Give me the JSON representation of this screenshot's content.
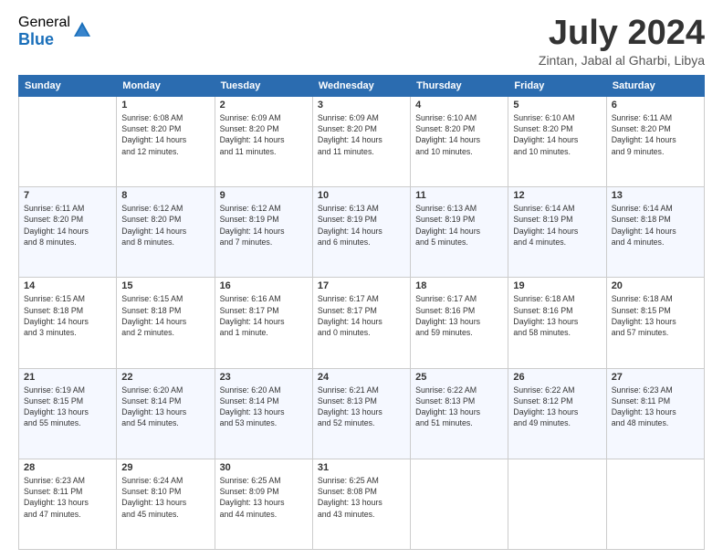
{
  "logo": {
    "general": "General",
    "blue": "Blue"
  },
  "title": "July 2024",
  "location": "Zintan, Jabal al Gharbi, Libya",
  "days_of_week": [
    "Sunday",
    "Monday",
    "Tuesday",
    "Wednesday",
    "Thursday",
    "Friday",
    "Saturday"
  ],
  "weeks": [
    [
      {
        "day": "",
        "info": ""
      },
      {
        "day": "1",
        "info": "Sunrise: 6:08 AM\nSunset: 8:20 PM\nDaylight: 14 hours\nand 12 minutes."
      },
      {
        "day": "2",
        "info": "Sunrise: 6:09 AM\nSunset: 8:20 PM\nDaylight: 14 hours\nand 11 minutes."
      },
      {
        "day": "3",
        "info": "Sunrise: 6:09 AM\nSunset: 8:20 PM\nDaylight: 14 hours\nand 11 minutes."
      },
      {
        "day": "4",
        "info": "Sunrise: 6:10 AM\nSunset: 8:20 PM\nDaylight: 14 hours\nand 10 minutes."
      },
      {
        "day": "5",
        "info": "Sunrise: 6:10 AM\nSunset: 8:20 PM\nDaylight: 14 hours\nand 10 minutes."
      },
      {
        "day": "6",
        "info": "Sunrise: 6:11 AM\nSunset: 8:20 PM\nDaylight: 14 hours\nand 9 minutes."
      }
    ],
    [
      {
        "day": "7",
        "info": "Sunrise: 6:11 AM\nSunset: 8:20 PM\nDaylight: 14 hours\nand 8 minutes."
      },
      {
        "day": "8",
        "info": "Sunrise: 6:12 AM\nSunset: 8:20 PM\nDaylight: 14 hours\nand 8 minutes."
      },
      {
        "day": "9",
        "info": "Sunrise: 6:12 AM\nSunset: 8:19 PM\nDaylight: 14 hours\nand 7 minutes."
      },
      {
        "day": "10",
        "info": "Sunrise: 6:13 AM\nSunset: 8:19 PM\nDaylight: 14 hours\nand 6 minutes."
      },
      {
        "day": "11",
        "info": "Sunrise: 6:13 AM\nSunset: 8:19 PM\nDaylight: 14 hours\nand 5 minutes."
      },
      {
        "day": "12",
        "info": "Sunrise: 6:14 AM\nSunset: 8:19 PM\nDaylight: 14 hours\nand 4 minutes."
      },
      {
        "day": "13",
        "info": "Sunrise: 6:14 AM\nSunset: 8:18 PM\nDaylight: 14 hours\nand 4 minutes."
      }
    ],
    [
      {
        "day": "14",
        "info": "Sunrise: 6:15 AM\nSunset: 8:18 PM\nDaylight: 14 hours\nand 3 minutes."
      },
      {
        "day": "15",
        "info": "Sunrise: 6:15 AM\nSunset: 8:18 PM\nDaylight: 14 hours\nand 2 minutes."
      },
      {
        "day": "16",
        "info": "Sunrise: 6:16 AM\nSunset: 8:17 PM\nDaylight: 14 hours\nand 1 minute."
      },
      {
        "day": "17",
        "info": "Sunrise: 6:17 AM\nSunset: 8:17 PM\nDaylight: 14 hours\nand 0 minutes."
      },
      {
        "day": "18",
        "info": "Sunrise: 6:17 AM\nSunset: 8:16 PM\nDaylight: 13 hours\nand 59 minutes."
      },
      {
        "day": "19",
        "info": "Sunrise: 6:18 AM\nSunset: 8:16 PM\nDaylight: 13 hours\nand 58 minutes."
      },
      {
        "day": "20",
        "info": "Sunrise: 6:18 AM\nSunset: 8:15 PM\nDaylight: 13 hours\nand 57 minutes."
      }
    ],
    [
      {
        "day": "21",
        "info": "Sunrise: 6:19 AM\nSunset: 8:15 PM\nDaylight: 13 hours\nand 55 minutes."
      },
      {
        "day": "22",
        "info": "Sunrise: 6:20 AM\nSunset: 8:14 PM\nDaylight: 13 hours\nand 54 minutes."
      },
      {
        "day": "23",
        "info": "Sunrise: 6:20 AM\nSunset: 8:14 PM\nDaylight: 13 hours\nand 53 minutes."
      },
      {
        "day": "24",
        "info": "Sunrise: 6:21 AM\nSunset: 8:13 PM\nDaylight: 13 hours\nand 52 minutes."
      },
      {
        "day": "25",
        "info": "Sunrise: 6:22 AM\nSunset: 8:13 PM\nDaylight: 13 hours\nand 51 minutes."
      },
      {
        "day": "26",
        "info": "Sunrise: 6:22 AM\nSunset: 8:12 PM\nDaylight: 13 hours\nand 49 minutes."
      },
      {
        "day": "27",
        "info": "Sunrise: 6:23 AM\nSunset: 8:11 PM\nDaylight: 13 hours\nand 48 minutes."
      }
    ],
    [
      {
        "day": "28",
        "info": "Sunrise: 6:23 AM\nSunset: 8:11 PM\nDaylight: 13 hours\nand 47 minutes."
      },
      {
        "day": "29",
        "info": "Sunrise: 6:24 AM\nSunset: 8:10 PM\nDaylight: 13 hours\nand 45 minutes."
      },
      {
        "day": "30",
        "info": "Sunrise: 6:25 AM\nSunset: 8:09 PM\nDaylight: 13 hours\nand 44 minutes."
      },
      {
        "day": "31",
        "info": "Sunrise: 6:25 AM\nSunset: 8:08 PM\nDaylight: 13 hours\nand 43 minutes."
      },
      {
        "day": "",
        "info": ""
      },
      {
        "day": "",
        "info": ""
      },
      {
        "day": "",
        "info": ""
      }
    ]
  ]
}
